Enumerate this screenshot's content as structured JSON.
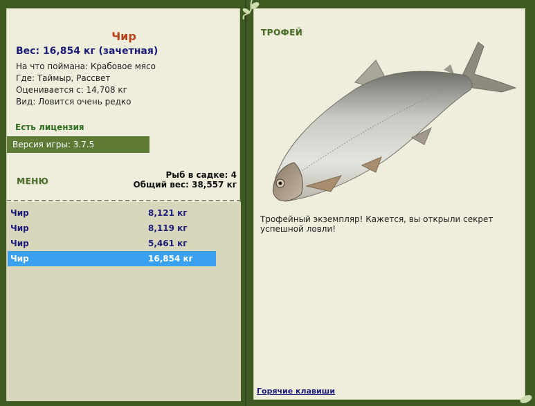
{
  "details": {
    "fish_name": "Чир",
    "weight": "Вес: 16,854 кг (зачетная)",
    "bait": "На что поймана: Крабовое мясо",
    "where": "Где: Таймыр, Рассвет",
    "value": "Оценивается с: 14,708 кг",
    "kind": "Вид: Ловится очень редко"
  },
  "license": "Есть лицензия",
  "version": "Версия игры: 3.7.5",
  "menu_label": "МЕНЮ",
  "cage": {
    "count_label": "Рыб в садке: 4",
    "total_label": "Общий вес: 38,557 кг"
  },
  "fish_list": [
    {
      "name": "Чир",
      "weight": "8,121 кг"
    },
    {
      "name": "Чир",
      "weight": "8,119 кг"
    },
    {
      "name": "Чир",
      "weight": "5,461 кг"
    },
    {
      "name": "Чир",
      "weight": "16,854 кг",
      "selected": true
    }
  ],
  "trophy": {
    "label": "ТРОФЕЙ",
    "text": "Трофейный экземпляр! Кажется, вы открыли секрет успешной ловли!",
    "image_icon": "fish-whitefish-image"
  },
  "hotkeys_link": "Горячие клавиши",
  "colors": {
    "frame": "#3f5a22",
    "panel_bg": "#efeedd",
    "list_bg": "#d8d6bb",
    "selected_row": "#3aa0f0",
    "title_red": "#b5421a",
    "navy": "#1c1c7a",
    "green_text": "#2f6d1f"
  }
}
